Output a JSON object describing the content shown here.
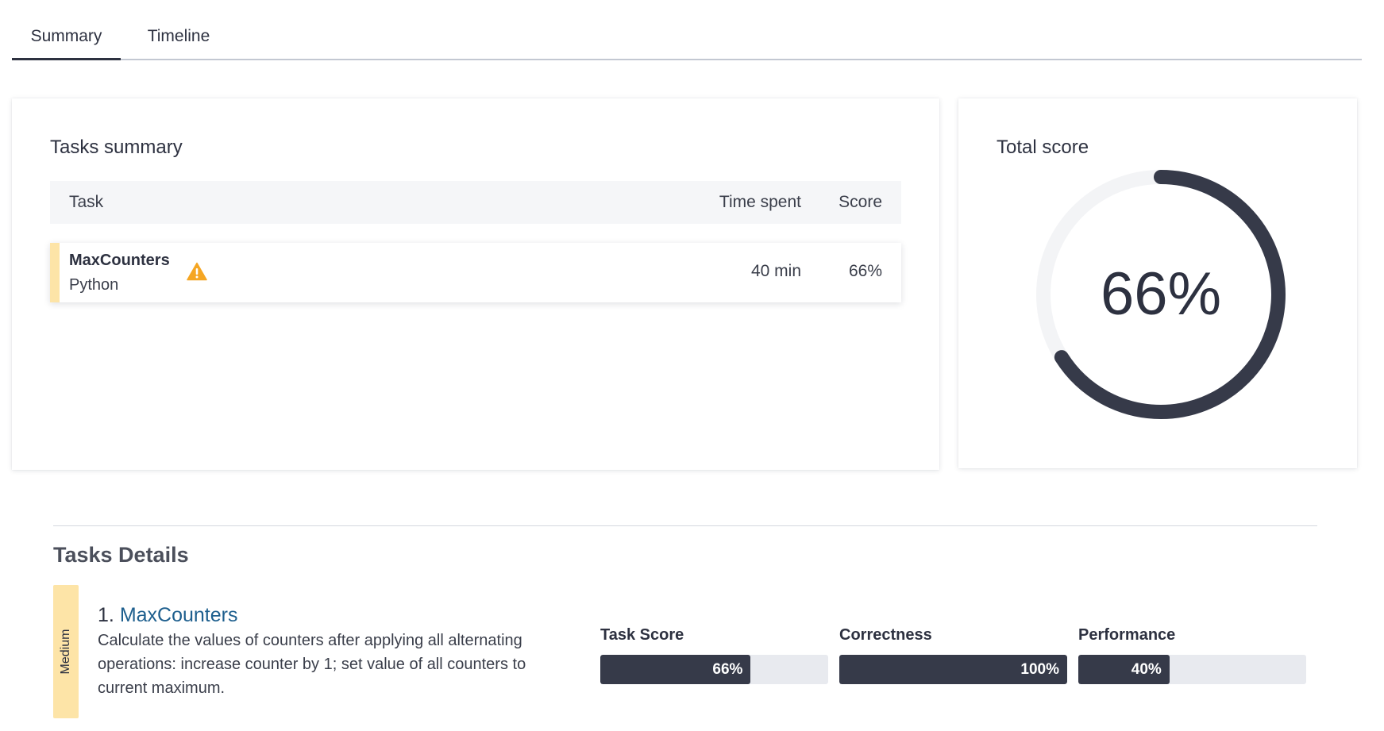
{
  "tabs": [
    {
      "label": "Summary",
      "active": true
    },
    {
      "label": "Timeline",
      "active": false
    }
  ],
  "tasks_summary": {
    "title": "Tasks summary",
    "columns": {
      "task": "Task",
      "time": "Time spent",
      "score": "Score"
    },
    "rows": [
      {
        "name": "MaxCounters",
        "language": "Python",
        "time": "40 min",
        "score": "66%",
        "warning": true,
        "warning_icon": "warning-triangle-icon",
        "accent_color": "#fde4a7"
      }
    ]
  },
  "total_score": {
    "title": "Total score",
    "value": "66%",
    "fraction": 0.66,
    "ring_color": "#363a49",
    "track_color": "#f3f4f6"
  },
  "tasks_details": {
    "title": "Tasks Details",
    "items": [
      {
        "difficulty": "Medium",
        "number": "1.",
        "name": "MaxCounters",
        "description": "Calculate the values of counters after applying all alternating operations: increase counter by 1; set value of all counters to current maximum.",
        "metrics": [
          {
            "label": "Task Score",
            "value": "66%",
            "fraction": 0.66
          },
          {
            "label": "Correctness",
            "value": "100%",
            "fraction": 1.0
          },
          {
            "label": "Performance",
            "value": "40%",
            "fraction": 0.4
          }
        ]
      }
    ]
  },
  "colors": {
    "accent_dark": "#363a49",
    "link": "#1e5f8e",
    "difficulty_medium": "#fde4a7",
    "warning": "#f5a623"
  }
}
